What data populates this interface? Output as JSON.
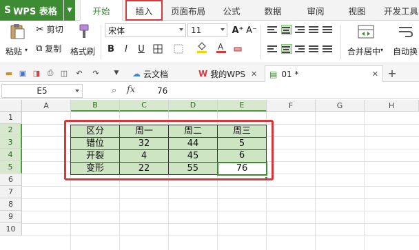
{
  "menubar": {
    "app_label": "WPS 表格",
    "app_logo": "S",
    "tabs": [
      {
        "label": "开始",
        "state": "active"
      },
      {
        "label": "插入",
        "state": "highlighted"
      },
      {
        "label": "页面布局"
      },
      {
        "label": "公式"
      },
      {
        "label": "数据"
      },
      {
        "label": "审阅"
      },
      {
        "label": "视图"
      },
      {
        "label": "开发工具"
      }
    ]
  },
  "ribbon": {
    "paste_label": "粘贴",
    "cut_label": "剪切",
    "copy_label": "复制",
    "format_painter_label": "格式刷",
    "font_name": "宋体",
    "font_size": "11",
    "bold": "B",
    "italic": "I",
    "underline": "U",
    "grow_font": "A⁺",
    "shrink_font": "A⁻",
    "merge_label": "合并居中",
    "wrap_label": "自动换",
    "font_color": "#d9363b",
    "fill_color": "#f5d400"
  },
  "quickbar": {
    "doc_tabs": [
      {
        "label": "云文档"
      },
      {
        "label": "我的WPS"
      },
      {
        "label": "01 *"
      }
    ]
  },
  "formula_bar": {
    "cell_ref": "E5",
    "fx": "fx",
    "value": "76"
  },
  "grid": {
    "columns": [
      "A",
      "B",
      "C",
      "D",
      "E",
      "F",
      "G",
      "H"
    ],
    "rows": [
      "1",
      "2",
      "3",
      "4",
      "5",
      "6",
      "7",
      "8",
      "9",
      "10"
    ],
    "table": [
      [
        "区分",
        "周一",
        "周二",
        "周三"
      ],
      [
        "错位",
        "32",
        "44",
        "5"
      ],
      [
        "开裂",
        "4",
        "45",
        "6"
      ],
      [
        "变形",
        "22",
        "55",
        "76"
      ]
    ],
    "selection_color": "#cde5c3",
    "highlight_color": "#d9363b"
  }
}
